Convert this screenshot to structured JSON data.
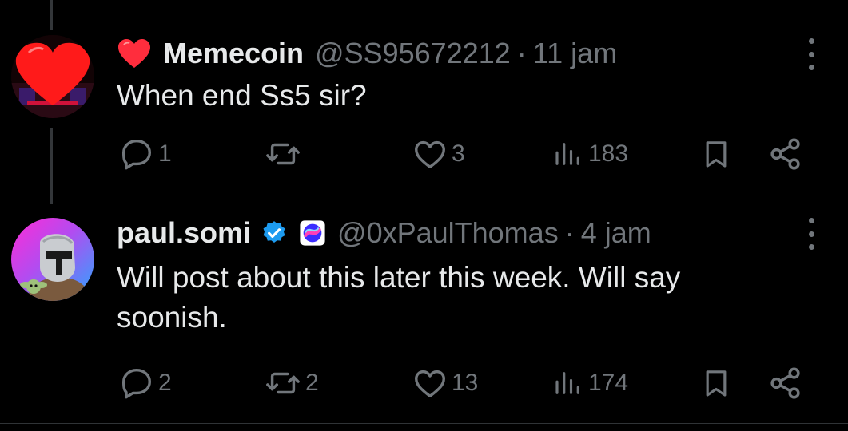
{
  "tweets": [
    {
      "display_name": "Memecoin",
      "name_prefix_icon": "heart-emoji",
      "handle": "@SS95672212",
      "separator": "·",
      "time": "11 jam",
      "text": "When end Ss5 sir?",
      "replies": "1",
      "reposts": "",
      "likes": "3",
      "views": "183"
    },
    {
      "display_name": "paul.somi",
      "verified": true,
      "affiliate_badge": "somnia-badge",
      "handle": "@0xPaulThomas",
      "separator": "·",
      "time": "4 jam",
      "text": "Will post about this later this week. Will say soonish.",
      "replies": "2",
      "reposts": "2",
      "likes": "13",
      "views": "174"
    }
  ],
  "colors": {
    "background": "#000000",
    "text": "#e7e9ea",
    "muted": "#71767b",
    "verified": "#1d9bf0",
    "heart": "#f91880"
  }
}
